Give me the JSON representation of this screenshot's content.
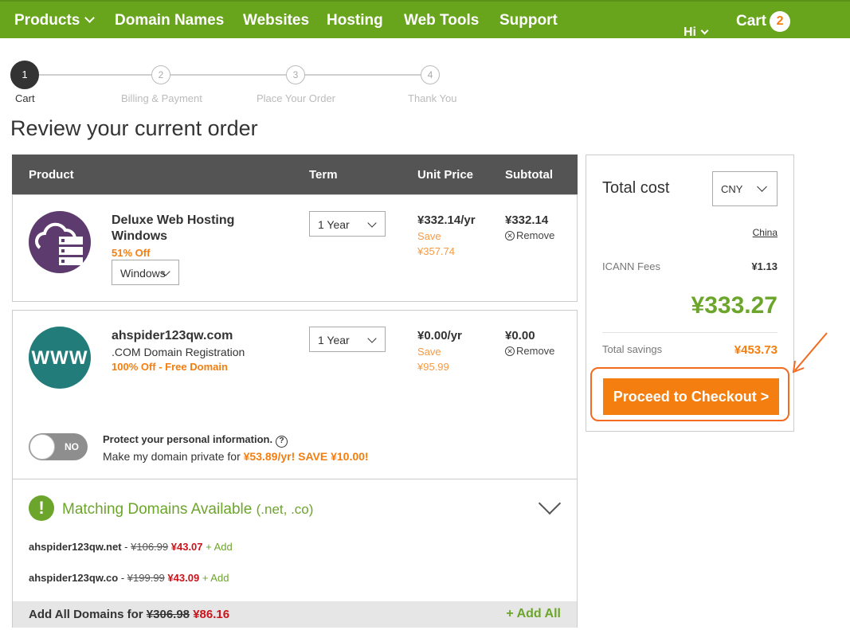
{
  "nav": {
    "items": [
      "Products",
      "Domain Names",
      "Websites",
      "Hosting",
      "Web Tools",
      "Support"
    ],
    "hi": "Hi",
    "cart_label": "Cart",
    "cart_count": "2"
  },
  "steps": [
    {
      "num": "1",
      "label": "Cart"
    },
    {
      "num": "2",
      "label": "Billing & Payment"
    },
    {
      "num": "3",
      "label": "Place Your Order"
    },
    {
      "num": "4",
      "label": "Thank You"
    }
  ],
  "page_title": "Review your current order",
  "table_headers": {
    "product": "Product",
    "term": "Term",
    "unit_price": "Unit Price",
    "subtotal": "Subtotal"
  },
  "items": [
    {
      "name_line1": "Deluxe Web Hosting",
      "name_line2": "Windows",
      "discount": "51% Off",
      "os_select": "Windows",
      "term": "1 Year",
      "unit_price": "¥332.14/yr",
      "save_label": "Save",
      "save_amount": "¥357.74",
      "subtotal": "¥332.14",
      "remove": "Remove",
      "icon": "cloud-server-icon"
    },
    {
      "name": "ahspider123qw.com",
      "desc": ".COM Domain Registration",
      "discount": "100% Off - Free Domain",
      "term": "1 Year",
      "unit_price": "¥0.00/yr",
      "save_label": "Save",
      "save_amount": "¥95.99",
      "subtotal": "¥0.00",
      "remove": "Remove",
      "icon_text": "WWW"
    }
  ],
  "privacy": {
    "toggle": "NO",
    "title": "Protect your personal information.",
    "text": "Make my domain private for ",
    "highlight": "¥53.89/yr! SAVE ¥10.00!"
  },
  "matching": {
    "title": "Matching Domains Available",
    "tlds": "(.net, .co)",
    "rows": [
      {
        "domain": "ahspider123qw.net",
        "old": "¥106.99",
        "new": "¥43.07",
        "add": "+ Add"
      },
      {
        "domain": "ahspider123qw.co",
        "old": "¥199.99",
        "new": "¥43.09",
        "add": "+ Add"
      }
    ],
    "add_all_label": "Add All Domains for",
    "add_all_old": "¥306.98",
    "add_all_new": "¥86.16",
    "add_all_button": "+ Add All"
  },
  "summary": {
    "title": "Total cost",
    "currency": "CNY",
    "country": "China",
    "icann_label": "ICANN Fees",
    "icann_value": "¥1.13",
    "total": "¥333.27",
    "savings_label": "Total savings",
    "savings_value": "¥453.73",
    "checkout": "Proceed to Checkout >"
  },
  "colors": {
    "brand_green": "#68a51c",
    "accent_orange": "#f47e0f",
    "sale_red": "#c9141b",
    "header_gray": "#545454"
  }
}
